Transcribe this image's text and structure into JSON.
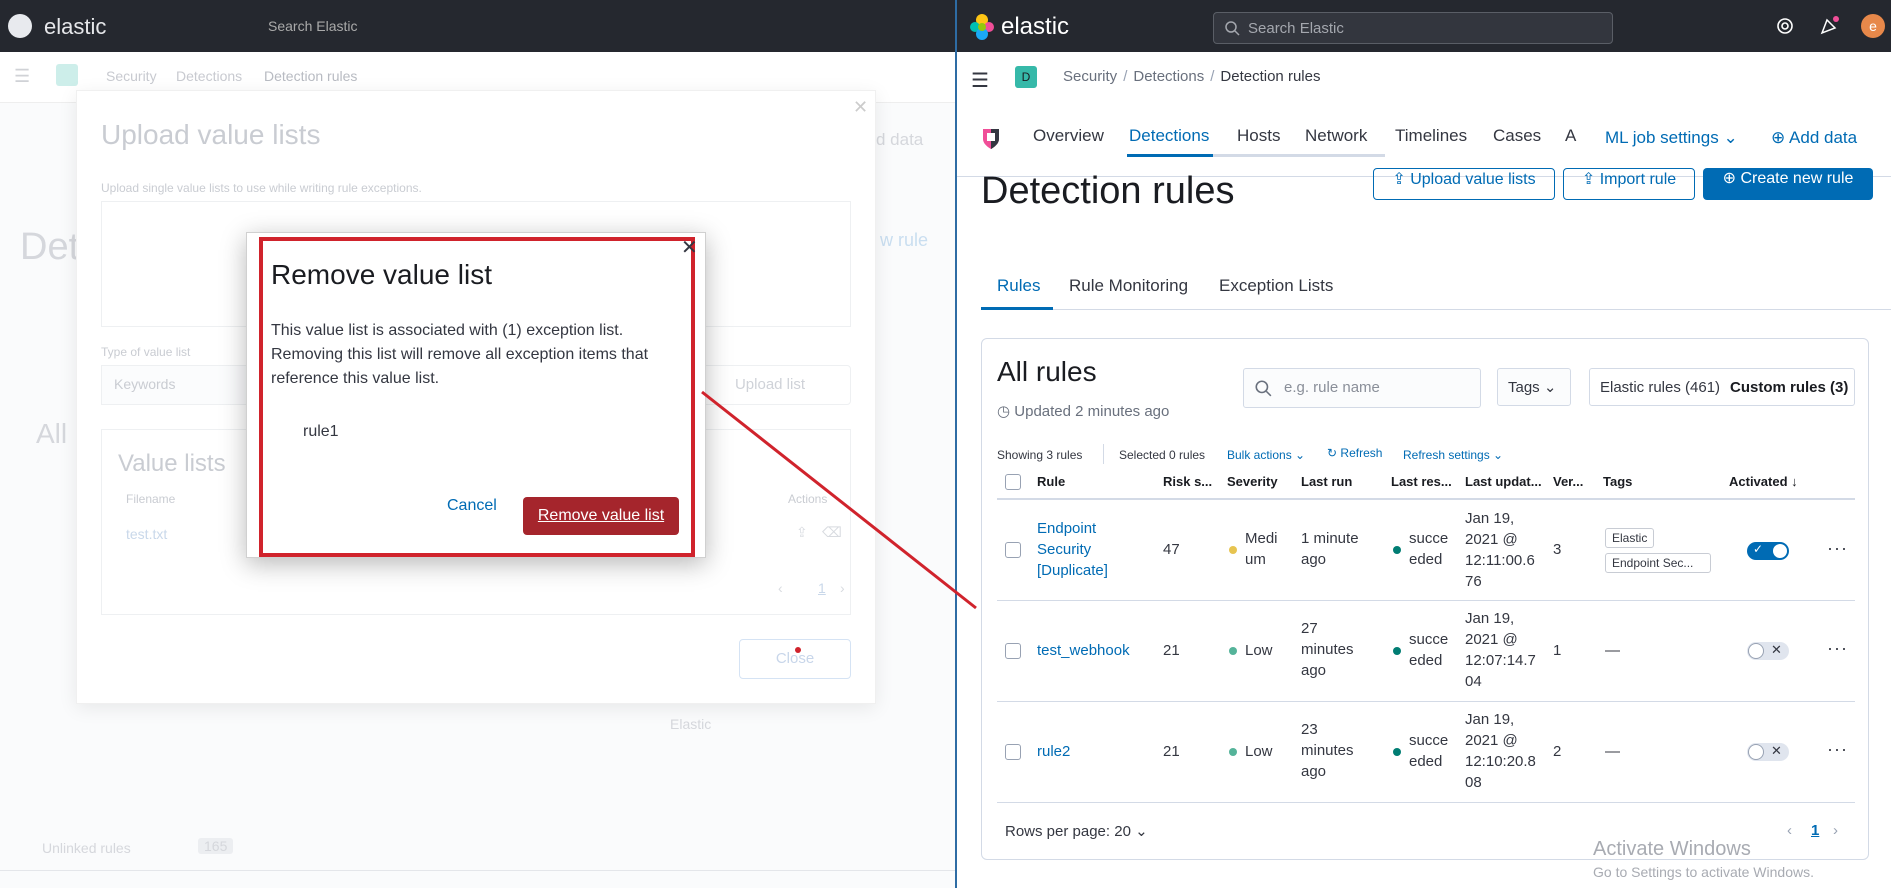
{
  "left": {
    "logo_text": "elastic",
    "search_placeholder": "Search Elastic",
    "crumbs": [
      "Security",
      "Detections",
      "Detection rules"
    ],
    "upload_modal": {
      "title": "Upload value lists",
      "subtitle": "Upload single value lists to use while writing rule exceptions.",
      "type_label": "Type of value list",
      "type_value": "Keywords",
      "upload_button": "Upload list",
      "value_lists_title": "Value lists",
      "col_filename": "Filename",
      "col_actions": "Actions",
      "file": "test.txt",
      "page": "1",
      "close_button": "Close"
    },
    "background": {
      "title_fragment": "Det",
      "all_fragment": "All",
      "create_fragment": "w rule",
      "data_fragment": "d data",
      "elastic_fragment": "Elastic",
      "unlinked": "Unlinked rules",
      "unlinked_count": "165"
    },
    "remove_dialog": {
      "title": "Remove value list",
      "body": "This value list is associated with (1) exception list. Removing this list will remove all exception items that reference this value list.",
      "item": "rule1",
      "cancel": "Cancel",
      "confirm": "Remove value list"
    }
  },
  "right": {
    "logo_text": "elastic",
    "search_placeholder": "Search Elastic",
    "avatar": "e",
    "space": "D",
    "breadcrumbs": [
      "Security",
      "Detections",
      "Detection rules"
    ],
    "nav_tabs": [
      "Overview",
      "Detections",
      "Hosts",
      "Network",
      "Timelines",
      "Cases",
      "A"
    ],
    "ml_job_settings": "ML job settings",
    "add_data": "Add data",
    "page_title": "Detection rules",
    "upload_value_lists": "Upload value lists",
    "import_rule": "Import rule",
    "create_new_rule": "Create new rule",
    "tabs": [
      "Rules",
      "Rule Monitoring",
      "Exception Lists"
    ],
    "all_rules_title": "All rules",
    "updated": "Updated 2 minutes ago",
    "filter_placeholder": "e.g. rule name",
    "tags_label": "Tags",
    "elastic_rules": "Elastic rules (461)",
    "custom_rules": "Custom rules (3)",
    "showing": "Showing 3 rules",
    "selected": "Selected 0 rules",
    "bulk_actions": "Bulk actions",
    "refresh": "Refresh",
    "refresh_settings": "Refresh settings",
    "columns": [
      "Rule",
      "Risk s...",
      "Severity",
      "Last run",
      "Last res...",
      "Last updat...",
      "Ver...",
      "Tags",
      "Activated"
    ],
    "rows": [
      {
        "name": [
          "Endpoint",
          "Security",
          "[Duplicate]"
        ],
        "risk": "47",
        "severity": [
          "Medi",
          "um"
        ],
        "severity_color": "#e7c450",
        "last_run": [
          "1 minute",
          "ago"
        ],
        "last_response": [
          "succe",
          "eded"
        ],
        "updated": [
          "Jan 19,",
          "2021 @",
          "12:11:00.6",
          "76"
        ],
        "version": "3",
        "tags": [
          "Elastic",
          "Endpoint Sec..."
        ],
        "activated": true
      },
      {
        "name": [
          "test_webhook"
        ],
        "risk": "21",
        "severity": [
          "Low"
        ],
        "severity_color": "#54b399",
        "last_run": [
          "27",
          "minutes",
          "ago"
        ],
        "last_response": [
          "succe",
          "eded"
        ],
        "updated": [
          "Jan 19,",
          "2021 @",
          "12:07:14.7",
          "04"
        ],
        "version": "1",
        "tags": [
          "—"
        ],
        "activated": false
      },
      {
        "name": [
          "rule2"
        ],
        "risk": "21",
        "severity": [
          "Low"
        ],
        "severity_color": "#54b399",
        "last_run": [
          "23",
          "minutes",
          "ago"
        ],
        "last_response": [
          "succe",
          "eded"
        ],
        "updated": [
          "Jan 19,",
          "2021 @",
          "12:10:20.8",
          "08"
        ],
        "version": "2",
        "tags": [
          "—"
        ],
        "activated": false
      }
    ],
    "rows_per_page": "Rows per page: 20",
    "page": "1",
    "activate_windows": "Activate Windows",
    "activate_windows_sub": "Go to Settings to activate Windows."
  },
  "colors": {
    "accent": "#006bb4",
    "danger": "#a5252c",
    "annotation_red": "#d0232c",
    "header": "#25282f"
  }
}
